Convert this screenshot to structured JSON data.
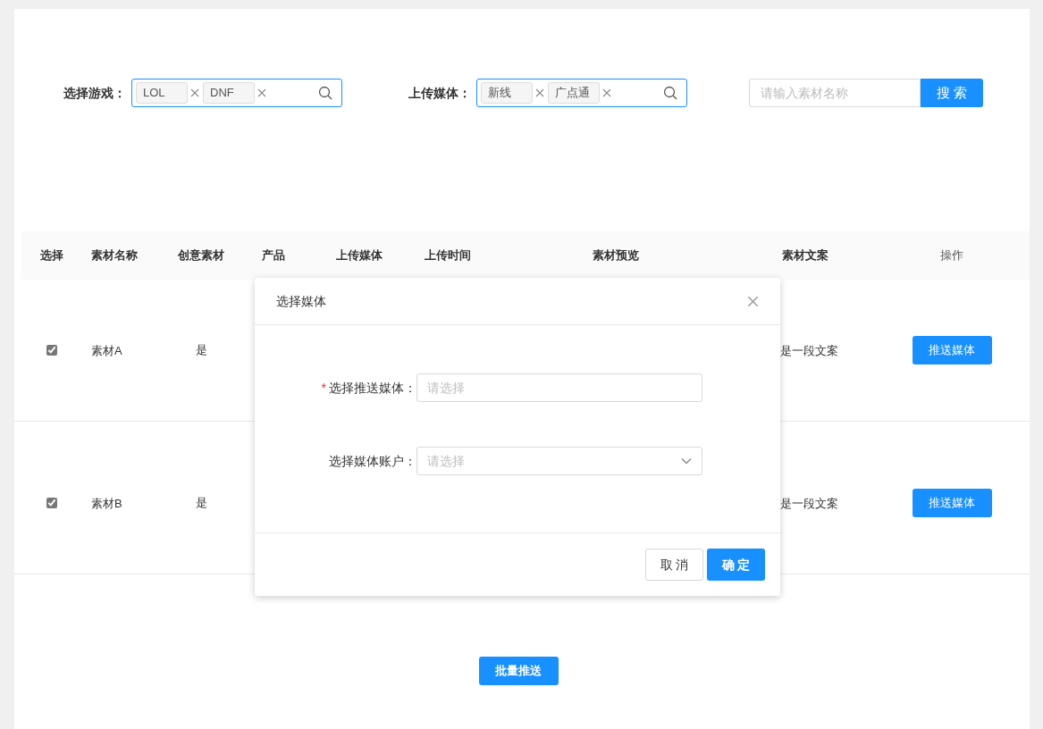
{
  "filters": [
    {
      "label": "选择游戏：",
      "tags": [
        "LOL",
        "DNF"
      ]
    },
    {
      "label": "上传媒体：",
      "tags": [
        "新线",
        "广点通"
      ]
    }
  ],
  "search": {
    "placeholder": "请输入素材名称",
    "button": "搜 索"
  },
  "table": {
    "columns": [
      "选择",
      "素材名称",
      "创意素材",
      "产品",
      "上传媒体",
      "上传时间",
      "素材预览",
      "素材文案",
      "操作"
    ],
    "rows": [
      {
        "checked": true,
        "name": "素材A",
        "creative": "是",
        "copy": "是一段文案",
        "action": "推送媒体"
      },
      {
        "checked": true,
        "name": "素材B",
        "creative": "是",
        "copy": "是一段文案",
        "action": "推送媒体"
      }
    ]
  },
  "batch_button": "批量推送",
  "dialog": {
    "title": "选择媒体",
    "fields": [
      {
        "mark": "*",
        "label": "选择推送媒体：",
        "kind": "input",
        "placeholder": "请选择"
      },
      {
        "label": "选择媒体账户：",
        "kind": "select",
        "placeholder": "请选择"
      }
    ],
    "buttons": [
      {
        "label": "取 消",
        "kind": "default"
      },
      {
        "label": "确 定",
        "kind": "primary"
      }
    ]
  }
}
